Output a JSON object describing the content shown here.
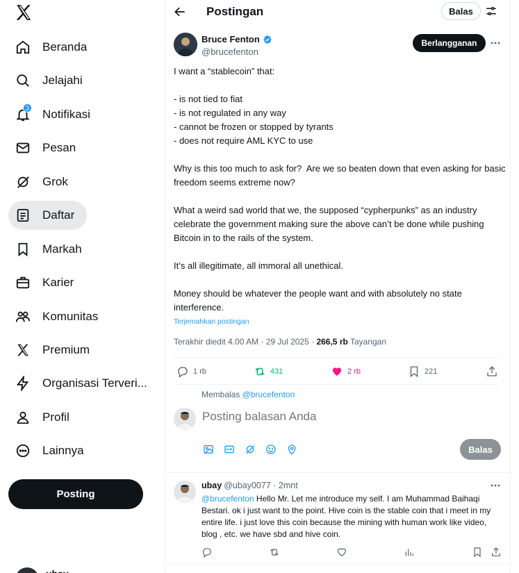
{
  "nav": {
    "items": [
      {
        "label": "Beranda",
        "icon": "home-icon"
      },
      {
        "label": "Jelajahi",
        "icon": "search-icon"
      },
      {
        "label": "Notifikasi",
        "icon": "bell-icon",
        "badge": "3"
      },
      {
        "label": "Pesan",
        "icon": "mail-icon"
      },
      {
        "label": "Grok",
        "icon": "grok-icon"
      },
      {
        "label": "Daftar",
        "icon": "list-icon",
        "active": true
      },
      {
        "label": "Markah",
        "icon": "bookmark-icon"
      },
      {
        "label": "Karier",
        "icon": "briefcase-icon"
      },
      {
        "label": "Komunitas",
        "icon": "people-icon"
      },
      {
        "label": "Premium",
        "icon": "x-logo-icon"
      },
      {
        "label": "Organisasi Terveri...",
        "icon": "lightning-icon"
      },
      {
        "label": "Profil",
        "icon": "person-icon"
      },
      {
        "label": "Lainnya",
        "icon": "more-circle-icon"
      }
    ],
    "post_button": "Posting",
    "account_name": "ubay"
  },
  "header": {
    "title": "Postingan",
    "reply_chip": "Balas"
  },
  "post": {
    "author_name": "Bruce Fenton",
    "author_handle": "@brucefenton",
    "subscribe_label": "Berlangganan",
    "paragraphs": [
      "I want a “stablecoin” that:",
      "",
      "- is not tied to fiat",
      "- is not regulated in any way",
      "- cannot be frozen or stopped by tyrants",
      "- does not require AML KYC to use",
      "",
      "Why is this too much to ask for?  Are we so beaten down that even asking for basic freedom seems extreme now?",
      "",
      "What a weird sad world that we, the supposed “cypherpunks” as an industry celebrate the government making sure the above can’t be done while pushing Bitcoin in to the rails of the system.",
      "",
      "It’s all illegitimate, all immoral all unethical.",
      "",
      "Money should be whatever the people want and with absolutely no state interference."
    ],
    "translate_label": "Terjemahkan postingan",
    "edited_label": "Terakhir diedit 4.00 AM · 29 Jul 2025 · ",
    "views_count": "266,5 rb",
    "views_label": " Tayangan",
    "stats": {
      "replies": "1 rb",
      "reposts": "431",
      "likes": "2 rb",
      "bookmarks": "221"
    }
  },
  "composer": {
    "replying_prefix": "Membalas ",
    "replying_handle": "@brucefenton",
    "placeholder": "Posting balasan Anda",
    "submit_label": "Balas"
  },
  "reply": {
    "name": "ubay",
    "meta": "@ubay0077 · 2mnt",
    "mention": "@brucefenton",
    "text": " Hello Mr. Let me introduce my self. I am Muhammad Baihaqi Bestari. ok i just want to the point. Hive coin is the stable coin that i meet in my entire life. i just love this coin because the mining with human work like video, blog , etc. we have sbd and hive coin."
  },
  "colors": {
    "accent": "#1d9bf0",
    "repost": "#00ba7c",
    "like": "#f91880",
    "text": "#0f1419",
    "muted": "#536471"
  }
}
